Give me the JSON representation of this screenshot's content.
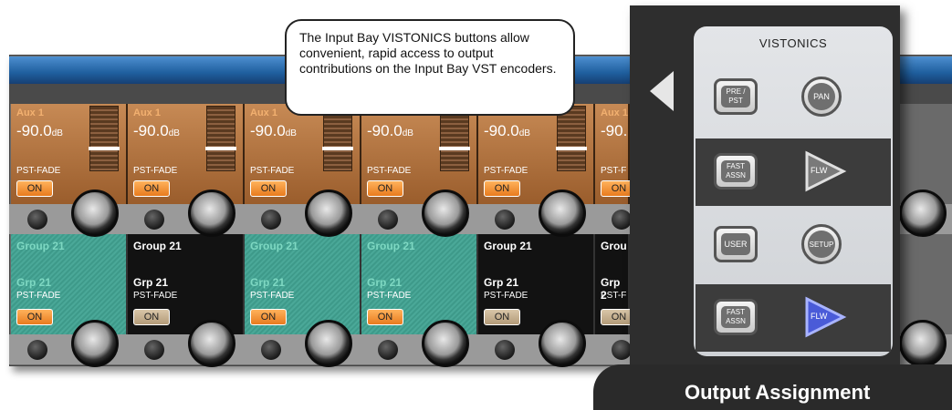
{
  "callout": {
    "text": "The Input Bay VISTONICS buttons allow convenient, rapid access to output contributions on the Input Bay VST encoders."
  },
  "aux_strips": [
    {
      "title": "Aux 1",
      "value": "-90.0",
      "unit": "dB",
      "mode": "PST-FADE",
      "on": "ON"
    },
    {
      "title": "Aux 1",
      "value": "-90.0",
      "unit": "dB",
      "mode": "PST-FADE",
      "on": "ON"
    },
    {
      "title": "Aux 1",
      "value": "-90.0",
      "unit": "dB",
      "mode": "PST-FADE",
      "on": "ON"
    },
    {
      "title": "",
      "value": "-90.0",
      "unit": "dB",
      "mode": "PST-FADE",
      "on": "ON"
    },
    {
      "title": "",
      "value": "-90.0",
      "unit": "dB",
      "mode": "PST-FADE",
      "on": "ON"
    },
    {
      "title": "Aux 1",
      "value": "-90.",
      "unit": "",
      "mode": "PST-F",
      "on": "ON"
    }
  ],
  "group_strips": [
    {
      "title": "Group 21",
      "sub": "Grp 21",
      "mode": "PST-FADE",
      "on": "ON",
      "style": "teal"
    },
    {
      "title": "Group 21",
      "sub": "Grp 21",
      "mode": "PST-FADE",
      "on": "ON",
      "style": "dark"
    },
    {
      "title": "Group 21",
      "sub": "Grp 21",
      "mode": "PST-FADE",
      "on": "ON",
      "style": "teal"
    },
    {
      "title": "Group 21",
      "sub": "Grp 21",
      "mode": "PST-FADE",
      "on": "ON",
      "style": "teal"
    },
    {
      "title": "Group 21",
      "sub": "Grp 21",
      "mode": "PST-FADE",
      "on": "ON",
      "style": "dark"
    },
    {
      "title": "Grou",
      "sub": "Grp 2",
      "mode": "PST-F",
      "on": "ON",
      "style": "dark"
    }
  ],
  "panel": {
    "title": "VISTONICS",
    "pre_pst": "PRE / PST",
    "pan": "PAN",
    "fast_assn_1": "FAST ASSN",
    "flw_1": "FLW",
    "user": "USER",
    "setup": "SETUP",
    "fast_assn_2": "FAST ASSN",
    "flw_2": "FLW"
  },
  "banner": {
    "text": "Output Assignment"
  },
  "colors": {
    "aux_title": "#f2b070",
    "teal_title": "#7ed8c2",
    "dark_title": "#ffffff",
    "on_active": "#f08a2a",
    "flw_active": "#4a5bd8"
  }
}
